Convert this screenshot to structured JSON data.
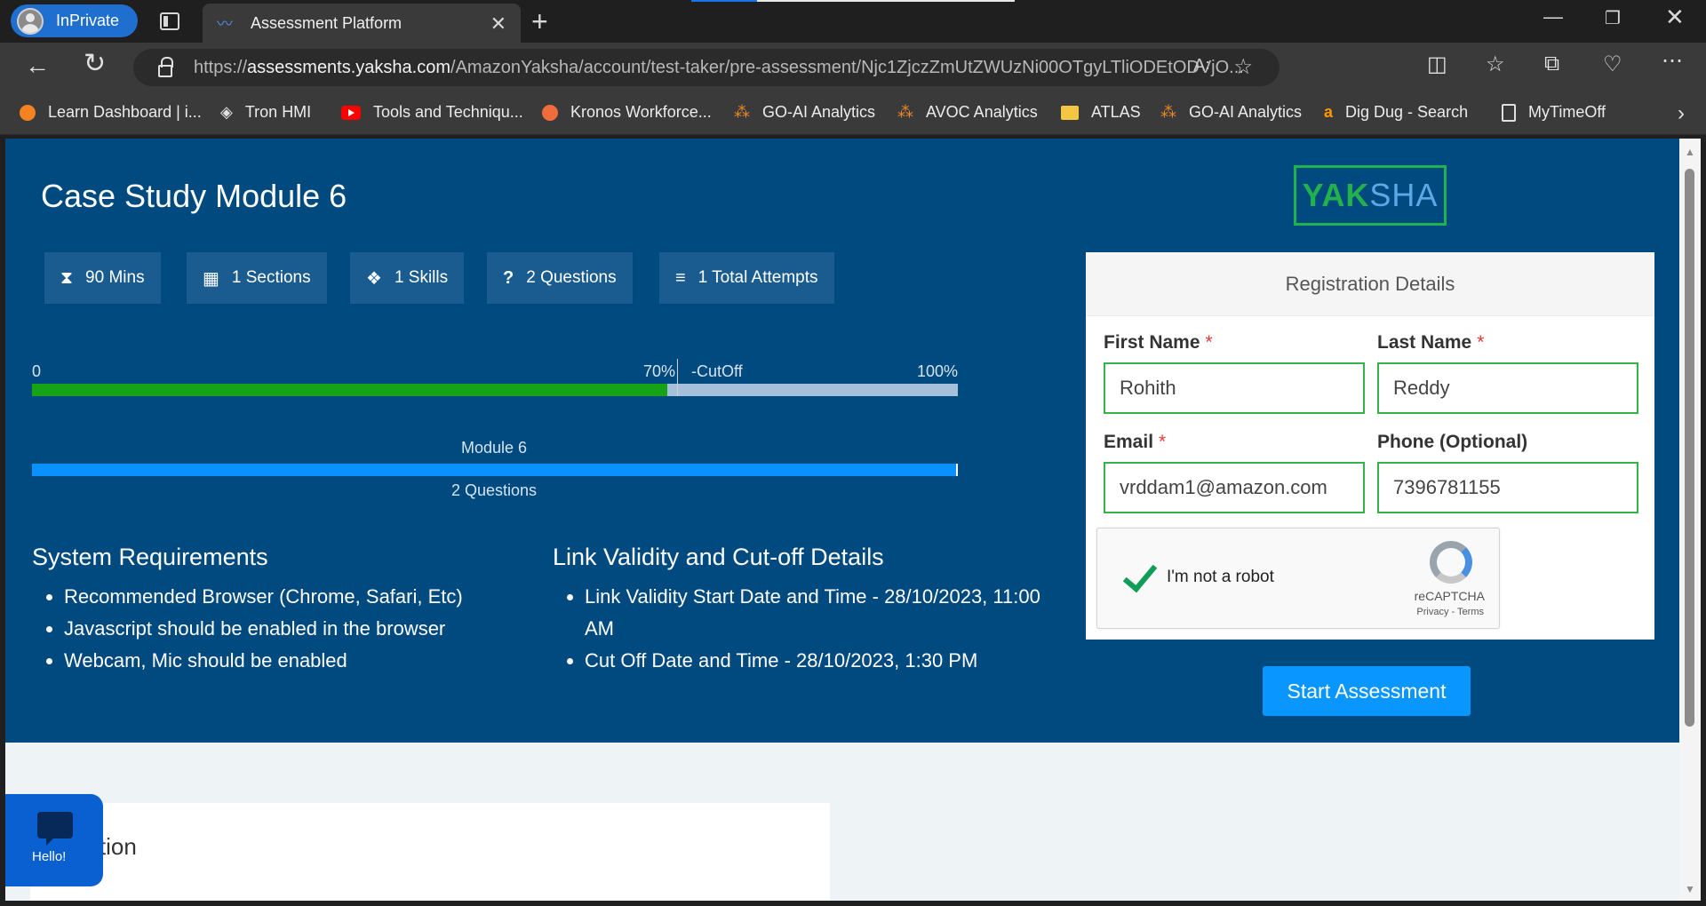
{
  "browser": {
    "inprivate_label": "InPrivate",
    "tab_title": "Assessment Platform",
    "url_prefix": "https://",
    "url_host": "assessments.yaksha.com",
    "url_path": "/AmazonYaksha/account/test-taker/pre-assessment/Njc1ZjczZmUtZWUzNi00OTgyLTliODEtODVjO..."
  },
  "bookmarks": [
    {
      "label": "Learn Dashboard | i...",
      "icon": "orange-circle-icon",
      "color": "#f58220"
    },
    {
      "label": "Tron HMI",
      "icon": "unity-icon",
      "color": "#e0e0e0"
    },
    {
      "label": "Tools and Techniqu...",
      "icon": "youtube-icon",
      "color": "#ff0000"
    },
    {
      "label": "Kronos Workforce...",
      "icon": "kronos-icon",
      "color": "#f26b3a"
    },
    {
      "label": "GO-AI Analytics",
      "icon": "nodes-icon",
      "color": "#f08a24"
    },
    {
      "label": "AVOC Analytics",
      "icon": "nodes-icon",
      "color": "#f08a24"
    },
    {
      "label": "ATLAS",
      "icon": "folder-icon",
      "color": "#f3c744"
    },
    {
      "label": "GO-AI Analytics",
      "icon": "nodes-icon",
      "color": "#f08a24"
    },
    {
      "label": "Dig Dug - Search",
      "icon": "amazon-icon",
      "color": "#ff9900"
    },
    {
      "label": "MyTimeOff",
      "icon": "document-icon",
      "color": "#e0e0e0"
    }
  ],
  "page": {
    "title": "Case Study Module 6",
    "stats": [
      {
        "icon": "hourglass-icon",
        "label": "90 Mins"
      },
      {
        "icon": "sections-grid-icon",
        "label": "1 Sections"
      },
      {
        "icon": "skills-icon",
        "label": "1 Skills"
      },
      {
        "icon": "question-icon",
        "label": "2 Questions"
      },
      {
        "icon": "list-icon",
        "label": "1 Total Attempts"
      }
    ],
    "cutoff": {
      "min_label": "0",
      "cutoff_label": "70%",
      "cutoff_text": "-CutOff",
      "max_label": "100%",
      "cutoff_percent": 70
    },
    "module": {
      "name": "Module 6",
      "questions": "2 Questions",
      "fill_percent": 100
    },
    "system_requirements": {
      "title": "System Requirements",
      "items": [
        "Recommended Browser (Chrome, Safari, Etc)",
        "Javascript should be enabled in the browser",
        "Webcam, Mic should be enabled"
      ]
    },
    "link_validity": {
      "title": "Link Validity and Cut-off Details",
      "items": [
        "Link Validity Start Date and Time - 28/10/2023, 11:00 AM",
        "Cut Off Date and Time - 28/10/2023, 1:30 PM"
      ]
    },
    "logo": {
      "part1": "YAK",
      "part2": "SHA"
    },
    "registration": {
      "header": "Registration Details",
      "first_name_label": "First Name",
      "first_name_value": "Rohith",
      "last_name_label": "Last Name",
      "last_name_value": "Reddy",
      "email_label": "Email",
      "email_value": "vrddam1@amazon.com",
      "phone_label": "Phone (Optional)",
      "phone_value": "7396781155",
      "required_mark": "*",
      "captcha_text": "I'm not a robot",
      "captcha_brand": "reCAPTCHA",
      "captcha_links": "Privacy - Terms"
    },
    "start_button": "Start Assessment",
    "description_title": "cription",
    "chat_label": "Hello!"
  }
}
